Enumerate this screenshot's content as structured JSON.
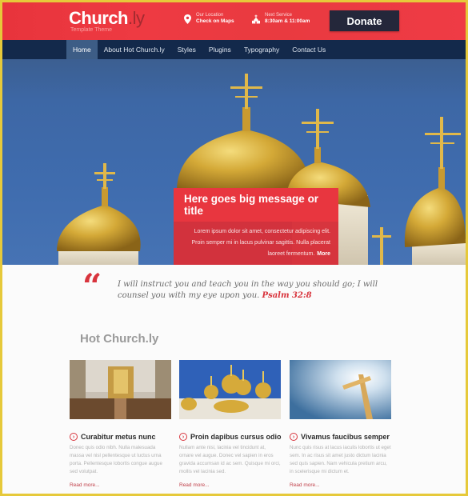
{
  "header": {
    "logo_main": "Church",
    "logo_suffix": ".ly",
    "tagline": "Template Theme",
    "location": {
      "icon": "map-pin-icon",
      "label": "Our Location",
      "value": "Check on Maps"
    },
    "service": {
      "icon": "church-icon",
      "label": "Next Service",
      "value": "8:30am & 11:00am"
    },
    "donate_label": "Donate"
  },
  "nav": {
    "items": [
      {
        "label": "Home",
        "active": true
      },
      {
        "label": "About Hot Church.ly",
        "active": false
      },
      {
        "label": "Styles",
        "active": false
      },
      {
        "label": "Plugins",
        "active": false
      },
      {
        "label": "Typography",
        "active": false
      },
      {
        "label": "Contact Us",
        "active": false
      }
    ]
  },
  "hero": {
    "image": "golden-domes-with-crosses",
    "title": "Here goes big message or title",
    "body": "Lorem ipsum dolor sit amet, consectetur adipiscing elit. Proin semper mi in lacus pulvinar sagittis. Nulla placerat laoreet fermentum.",
    "more_label": "More"
  },
  "quote": {
    "mark": "“",
    "text": "I will instruct you and teach you in the way you should go; I will counsel you with my eye upon you.",
    "reference": "Psalm 32:8"
  },
  "section": {
    "title": "Hot Church.ly",
    "cards": [
      {
        "image": "cathedral-interior",
        "title": "Curabitur metus nunc",
        "text": "Donec quis odio nibh. Nulla malesuada massa vel nisl pellentesque ut luctus urna porta. Pellentesque lobortis congue augue sed volutpat.",
        "link": "Read more..."
      },
      {
        "image": "golden-domes-cathedral",
        "title": "Proin dapibus cursus odio",
        "text": "Nullam ante nisi, lacinia vel tincidunt at, ornare vel augue. Donec vel sapien in eros gravida accumsan id ac sem. Quisque mi orci, mollis vel lacinia sed.",
        "link": "Read more..."
      },
      {
        "image": "cross-in-sky",
        "title": "Vivamus faucibus semper",
        "text": "Nunc quis risus at lacus iaculis lobortis ut eget sem. In ac risus sit amet justo dictum lacinia sed quis sapien. Nam vehicula pretium arcu, in scelerisque mi dictum et.",
        "link": "Read more..."
      }
    ]
  },
  "colors": {
    "accent": "#e8363f",
    "nav_bg": "#13294b",
    "donate_bg": "#24273a",
    "frame": "#e6c93a"
  }
}
